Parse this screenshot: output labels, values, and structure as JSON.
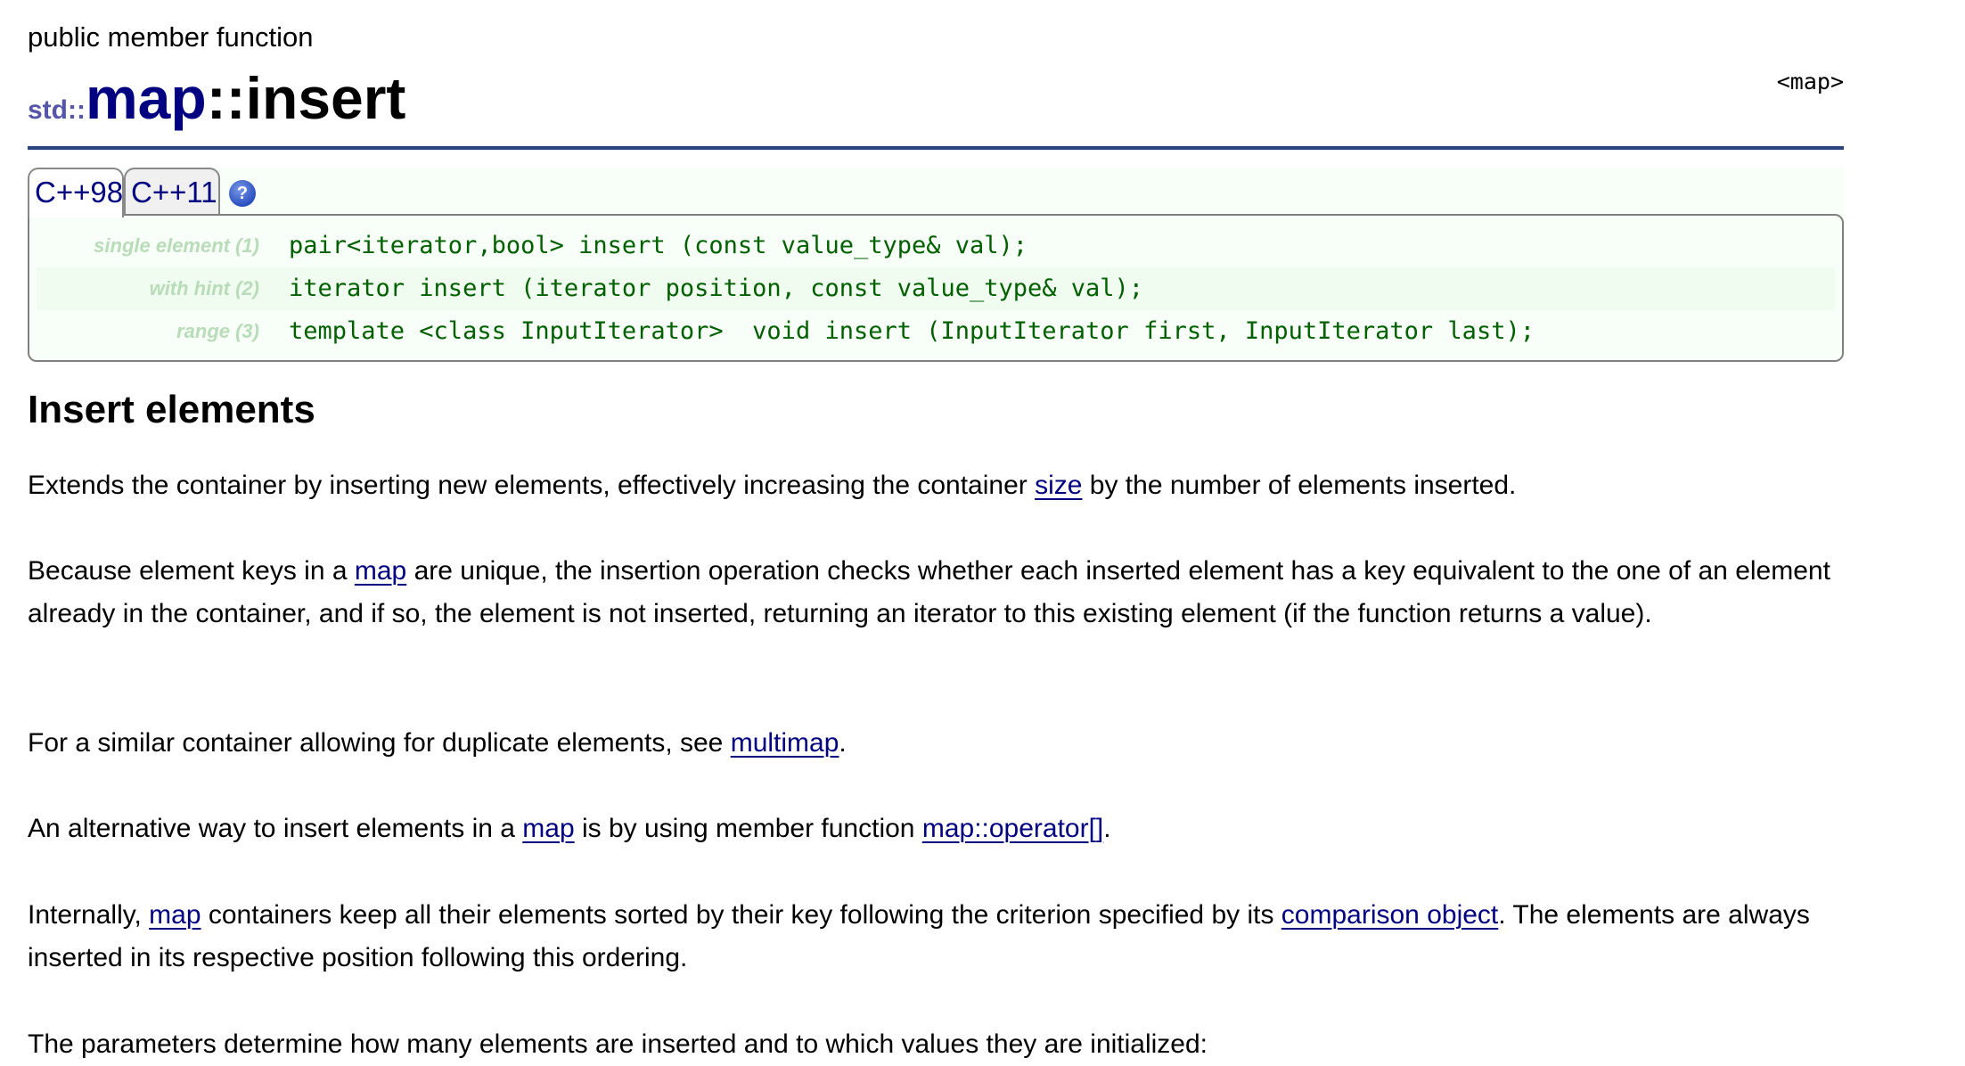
{
  "page": {
    "kind": "public member function",
    "header_ref": "<map>",
    "title": {
      "namespace": "std::",
      "class": "map",
      "function": "::insert"
    }
  },
  "tabs": [
    {
      "label": "C++98",
      "active": true
    },
    {
      "label": "C++11",
      "active": false
    }
  ],
  "help_icon": {
    "glyph": "?",
    "name": "help-icon"
  },
  "prototypes": [
    {
      "label": "single element (1)",
      "code": "pair<iterator,bool> insert (const value_type& val);"
    },
    {
      "label": "with hint (2)",
      "code": "iterator insert (iterator position, const value_type& val);"
    },
    {
      "label": "range (3)",
      "code": "template <class InputIterator>  void insert (InputIterator first, InputIterator last);"
    }
  ],
  "section_title": "Insert elements",
  "paragraphs": {
    "p1": {
      "a": "Extends the container by inserting new elements, effectively increasing the container ",
      "link": "size",
      "b": " by the number of elements inserted."
    },
    "p2": {
      "a": "Because element keys in a ",
      "link": "map",
      "b": " are unique, the insertion operation checks whether each inserted element has a key equivalent to the one of an element already in the container, and if so, the element is not inserted, returning an iterator to this existing element (if the function returns a value)."
    },
    "p3": {
      "a": "For a similar container allowing for duplicate elements, see ",
      "link": "multimap",
      "b": "."
    },
    "p4": {
      "a": "An alternative way to insert elements in a ",
      "link1": "map",
      "b": " is by using member function ",
      "link2": "map::operator[]",
      "c": "."
    },
    "p5": {
      "a": "Internally, ",
      "link1": "map",
      "b": " containers keep all their elements sorted by their key following the criterion specified by its ",
      "link2": "comparison object",
      "c": ". The elements are always inserted in its respective position following this ordering."
    },
    "p6": {
      "a": "The parameters determine how many elements are inserted and to which values they are initialized:"
    }
  },
  "colors": {
    "link": "#000080",
    "rule": "#2a4480",
    "code": "#006000",
    "proto_label": "#b8dcb8",
    "namespace": "#5555aa"
  }
}
